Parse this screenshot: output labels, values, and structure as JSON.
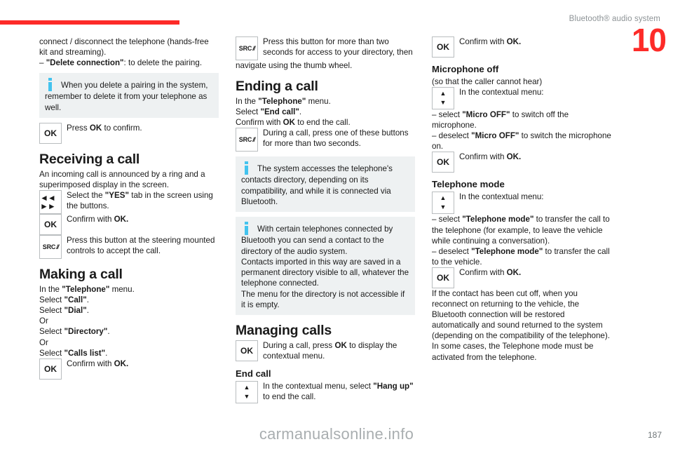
{
  "header": {
    "title": "Bluetooth® audio system",
    "chapter": "10"
  },
  "footer": {
    "page_number": "187",
    "watermark": "carmanualsonline.info"
  },
  "icons": {
    "ok": "OK",
    "src": "SRC",
    "src_glyph": "//",
    "seek": "◄◄ ►►",
    "up": "▲",
    "down": "▼"
  },
  "column1": {
    "intro_line1": "connect / disconnect the telephone (hands-free kit and streaming).",
    "intro_line2_dash": "–",
    "intro_line2_bold": "\"Delete connection\"",
    "intro_line2_rest": ": to delete the pairing.",
    "note1": "When you delete a pairing in the system, remember to delete it from your telephone as well.",
    "key_confirm_pre": "Press ",
    "key_confirm_bold": "OK",
    "key_confirm_post": " to confirm.",
    "h2_receiving": "Receiving a call",
    "receiving_intro": "An incoming call is announced by a ring and a superimposed display in the screen.",
    "key_yes_pre": "Select the ",
    "key_yes_bold": "\"YES\"",
    "key_yes_post": " tab in the screen using the buttons.",
    "key_ok_pre": "Confirm with ",
    "key_ok_bold": "OK.",
    "key_src_text": "Press this button at the steering mounted controls to accept the call.",
    "h2_making": "Making a call",
    "making_l1_pre": "In the ",
    "making_l1_bold": "\"Telephone\"",
    "making_l1_post": " menu.",
    "making_l2_pre": "Select ",
    "making_l2_bold": "\"Call\"",
    "making_l2_post": ".",
    "making_l3_pre": "Select ",
    "making_l3_bold": "\"Dial\"",
    "making_l3_post": ".",
    "making_or1": "Or",
    "making_l4_pre": "Select ",
    "making_l4_bold": "\"Directory\"",
    "making_l4_post": ".",
    "making_or2": "Or",
    "making_l5_pre": "Select ",
    "making_l5_bold": "\"Calls list\"",
    "making_l5_post": ".",
    "making_confirm_pre": "Confirm with ",
    "making_confirm_bold": "OK."
  },
  "column2": {
    "key_src_top": "Press this button for more than two seconds for access to your directory, then",
    "src_continuation": "navigate using the thumb wheel.",
    "h2_ending": "Ending a call",
    "ending_l1_pre": "In the ",
    "ending_l1_bold": "\"Telephone\"",
    "ending_l1_post": " menu.",
    "ending_l2_pre": "Select ",
    "ending_l2_bold": "\"End call\"",
    "ending_l2_post": ".",
    "ending_l3_pre": "Confirm with ",
    "ending_l3_bold": "OK",
    "ending_l3_post": " to end the call.",
    "key_src_call": "During a call, press one of these buttons for more than two seconds.",
    "note1": "The system accesses the telephone's contacts directory, depending on its compatibility, and while it is connected via Bluetooth.",
    "note2_p1": "With certain telephones connected by Bluetooth you can send a contact to the directory of the audio system.",
    "note2_p2": "Contacts imported in this way are saved in a permanent directory visible to all, whatever the telephone connected.",
    "note2_p3": "The menu for the directory is not accessible if it is empty.",
    "h2_managing": "Managing calls",
    "key_ok_pre": "During a call, press ",
    "key_ok_bold": "OK",
    "key_ok_post": " to display the contextual menu.",
    "h3_endcall": "End call",
    "key_updown_pre": "In the contextual menu, select ",
    "key_updown_bold": "\"Hang up\"",
    "key_updown_post": " to end the call."
  },
  "column3": {
    "key_ok_top_pre": "Confirm with ",
    "key_ok_top_bold": "OK.",
    "h3_microphone": "Microphone off",
    "micro_sub": "(so that the caller cannot hear)",
    "key_updown_text": "In the contextual menu:",
    "micro_l1_dash": "–",
    "micro_l1_pre": " select ",
    "micro_l1_bold": "\"Micro OFF\"",
    "micro_l1_post": " to switch off the microphone.",
    "micro_l2_dash": "–",
    "micro_l2_pre": " deselect ",
    "micro_l2_bold": "\"Micro OFF\"",
    "micro_l2_post": " to switch the microphone on.",
    "micro_confirm_pre": "Confirm with ",
    "micro_confirm_bold": "OK.",
    "h3_telmode": "Telephone mode",
    "tel_updown_text": "In the contextual menu:",
    "tel_l1_dash": "–",
    "tel_l1_pre": " select ",
    "tel_l1_bold": "\"Telephone mode\"",
    "tel_l1_post": " to transfer the call to the telephone (for example, to leave the vehicle while continuing a conversation).",
    "tel_l2_dash": "–",
    "tel_l2_pre": " deselect ",
    "tel_l2_bold": "\"Telephone mode\"",
    "tel_l2_post": " to transfer the call to the vehicle.",
    "tel_confirm_pre": "Confirm with ",
    "tel_confirm_bold": "OK.",
    "closing_p1": "If the contact has been cut off, when you reconnect on returning to the vehicle, the Bluetooth connection will be restored automatically and sound returned to the system (depending on the compatibility of the telephone).",
    "closing_p2": "In some cases, the Telephone mode must be activated from the telephone."
  }
}
